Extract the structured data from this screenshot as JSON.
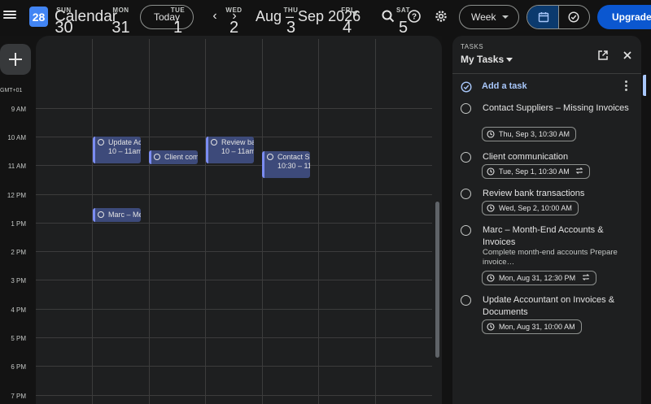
{
  "header": {
    "logo_day": "28",
    "app_name": "Calendar",
    "today_label": "Today",
    "prev_glyph": "‹",
    "next_glyph": "›",
    "range_title": "Aug – Sep 2026",
    "view_label": "Week",
    "upgrade_label": "Upgrade"
  },
  "week": {
    "days": [
      {
        "abbr": "SUN",
        "num": "30"
      },
      {
        "abbr": "MON",
        "num": "31"
      },
      {
        "abbr": "TUE",
        "num": "1"
      },
      {
        "abbr": "WED",
        "num": "2"
      },
      {
        "abbr": "THU",
        "num": "3"
      },
      {
        "abbr": "FRI",
        "num": "4"
      },
      {
        "abbr": "SAT",
        "num": "5"
      }
    ],
    "timezone": "GMT+01",
    "hours": [
      "9 AM",
      "10 AM",
      "11 AM",
      "12 PM",
      "1 PM",
      "2 PM",
      "3 PM",
      "4 PM",
      "5 PM",
      "6 PM",
      "7 PM"
    ]
  },
  "events": [
    {
      "title": "Update Ac",
      "time": "10 – 11am"
    },
    {
      "title": "Client com",
      "time": ""
    },
    {
      "title": "Review ba",
      "time": "10 – 11am"
    },
    {
      "title": "Contact S",
      "time": "10:30 – 11"
    },
    {
      "title": "Marc – Me",
      "time": ""
    }
  ],
  "tasks": {
    "panel_label": "TASKS",
    "list_name": "My Tasks",
    "add_label": "Add a task",
    "items": [
      {
        "title": "Contact Suppliers – Missing Invoices",
        "desc": "",
        "date": "Thu, Sep 3, 10:30 AM",
        "repeat": false
      },
      {
        "title": "Client communication",
        "desc": "",
        "date": "Tue, Sep 1, 10:30 AM",
        "repeat": true
      },
      {
        "title": "Review bank transactions",
        "desc": "",
        "date": "Wed, Sep 2, 10:00 AM",
        "repeat": false
      },
      {
        "title": "Marc – Month-End Accounts & Invoices",
        "desc": "Complete month-end accounts Prepare invoice…",
        "date": "Mon, Aug 31, 12:30 PM",
        "repeat": true
      },
      {
        "title": "Update Accountant on Invoices & Documents",
        "desc": "",
        "date": "Mon, Aug 31, 10:00 AM",
        "repeat": false
      }
    ]
  },
  "colors": {
    "background": "#121212",
    "panel": "#1e1f20",
    "event_fill": "#3d4a7a",
    "accent": "#a8c7fa",
    "upgrade": "#0b57d0"
  },
  "icons": [
    "menu-icon",
    "search-icon",
    "help-icon",
    "gear-icon",
    "calendar-icon",
    "task-check-icon",
    "plus-icon",
    "popout-icon",
    "close-icon",
    "add-task-icon",
    "more-vert-icon",
    "clock-icon",
    "repeat-icon",
    "circle-check-icon"
  ]
}
